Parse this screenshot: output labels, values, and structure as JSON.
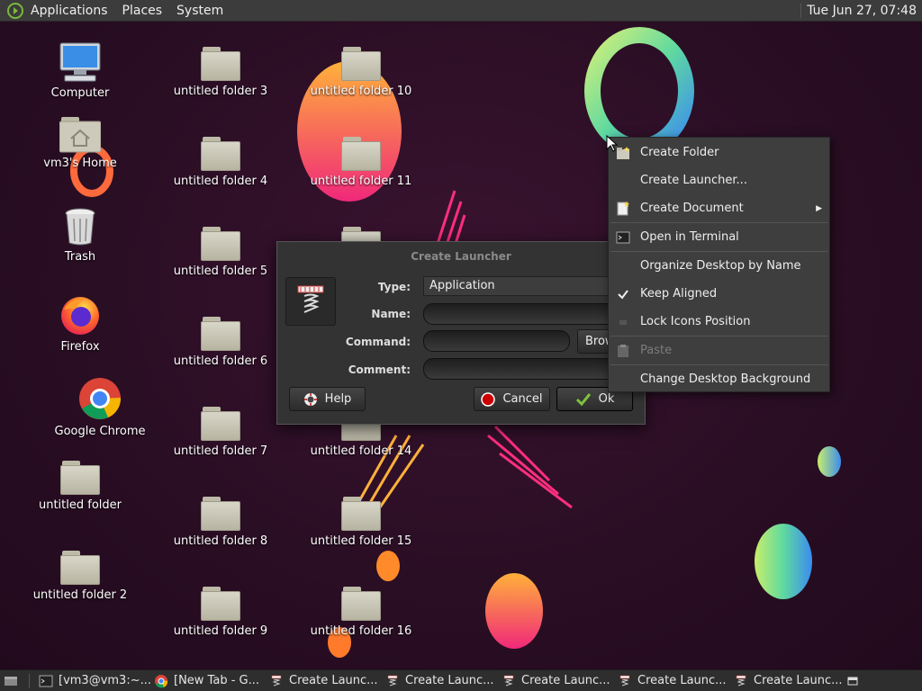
{
  "top_panel": {
    "menus": [
      "Applications",
      "Places",
      "System"
    ],
    "clock": "Tue Jun 27, 07:48"
  },
  "desktop_icons": {
    "col1": [
      "Computer",
      "vm3's Home",
      "Trash",
      "Firefox",
      "Google Chrome",
      "untitled folder",
      "untitled folder 2"
    ],
    "col2": [
      "untitled folder 3",
      "untitled folder 4",
      "untitled folder 5",
      "untitled folder 6",
      "untitled folder 7",
      "untitled folder 8",
      "untitled folder 9"
    ],
    "col3": [
      "untitled folder 10",
      "untitled folder 11",
      "untitled folder 14",
      "untitled folder 15",
      "untitled folder 16"
    ]
  },
  "dialog": {
    "title": "Create Launcher",
    "type_label": "Type:",
    "type_value": "Application",
    "name_label": "Name:",
    "command_label": "Command:",
    "comment_label": "Comment:",
    "browse_label": "Brow",
    "help_label": "Help",
    "cancel_label": "Cancel",
    "ok_label": "Ok"
  },
  "context_menu": {
    "items": [
      {
        "label": "Create Folder",
        "icon": "folder-new-icon",
        "enabled": true
      },
      {
        "label": "Create Launcher...",
        "icon": "",
        "enabled": true
      },
      {
        "label": "Create Document",
        "icon": "document-new-icon",
        "enabled": true,
        "submenu": true
      },
      {
        "label": "Open in Terminal",
        "icon": "terminal-icon",
        "enabled": true
      },
      {
        "label": "Organize Desktop by Name",
        "icon": "",
        "enabled": true
      },
      {
        "label": "Keep Aligned",
        "icon": "check-icon",
        "enabled": true,
        "checked": true
      },
      {
        "label": "Lock Icons Position",
        "icon": "",
        "enabled": true
      },
      {
        "label": "Paste",
        "icon": "paste-icon",
        "enabled": false
      },
      {
        "label": "Change Desktop Background",
        "icon": "",
        "enabled": true
      }
    ]
  },
  "taskbar": {
    "tasks": [
      "[vm3@vm3:~...",
      "[New Tab - G...",
      "Create Launc...",
      "Create Launc...",
      "Create Launc...",
      "Create Launc...",
      "Create Launc..."
    ]
  },
  "colors": {
    "panel_bg": "#3c3c3c",
    "desktop_bg": "#2a0e24",
    "menu_bg": "#3e3e3e",
    "dialog_bg": "#333333"
  }
}
